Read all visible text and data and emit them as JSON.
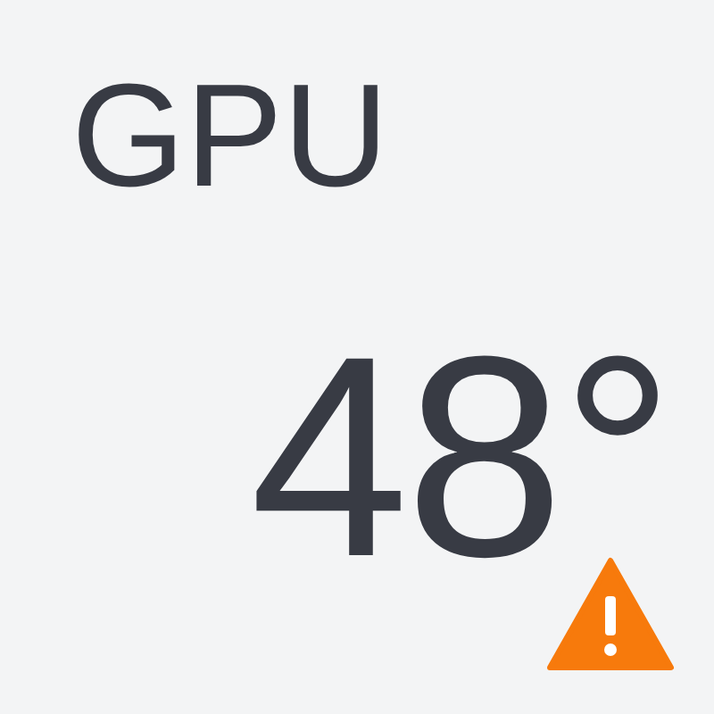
{
  "sensor": {
    "label": "GPU",
    "reading": "48°",
    "warning": true
  }
}
